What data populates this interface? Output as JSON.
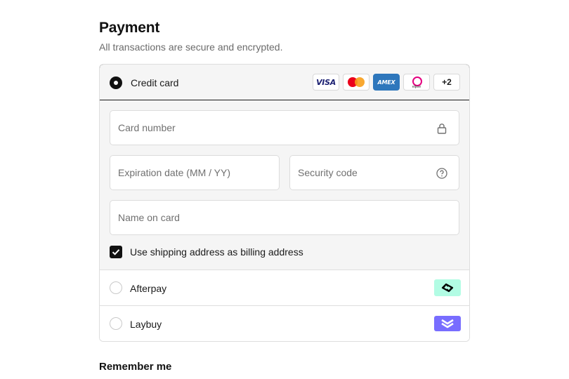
{
  "header": {
    "title": "Payment",
    "subtitle": "All transactions are secure and encrypted."
  },
  "credit_card": {
    "label": "Credit card",
    "selected": true,
    "card_logos": [
      "visa-icon",
      "mastercard-icon",
      "amex-icon",
      "elpoe-icon"
    ],
    "visa_text": "VISA",
    "amex_text": "AMEX",
    "elpoe_text": "elpoe",
    "more_badge": "+2"
  },
  "form": {
    "card_number": {
      "placeholder": "Card number",
      "value": "",
      "icon": "lock-icon"
    },
    "expiration": {
      "placeholder": "Expiration date (MM / YY)",
      "value": ""
    },
    "security_code": {
      "placeholder": "Security code",
      "value": "",
      "icon": "help-circle-icon"
    },
    "name_on_card": {
      "placeholder": "Name on card",
      "value": ""
    },
    "billing_checkbox": {
      "label": "Use shipping address as billing address",
      "checked": true
    }
  },
  "methods": [
    {
      "label": "Afterpay",
      "selected": false,
      "icon": "afterpay-icon",
      "color": "#b2fce4"
    },
    {
      "label": "Laybuy",
      "selected": false,
      "icon": "laybuy-icon",
      "color": "#786dff"
    }
  ],
  "remember": {
    "title": "Remember me"
  },
  "colors": {
    "accent": "#111111",
    "panel_bg": "#f5f5f5",
    "border": "#dedede",
    "muted_text": "#6b6b6b"
  }
}
